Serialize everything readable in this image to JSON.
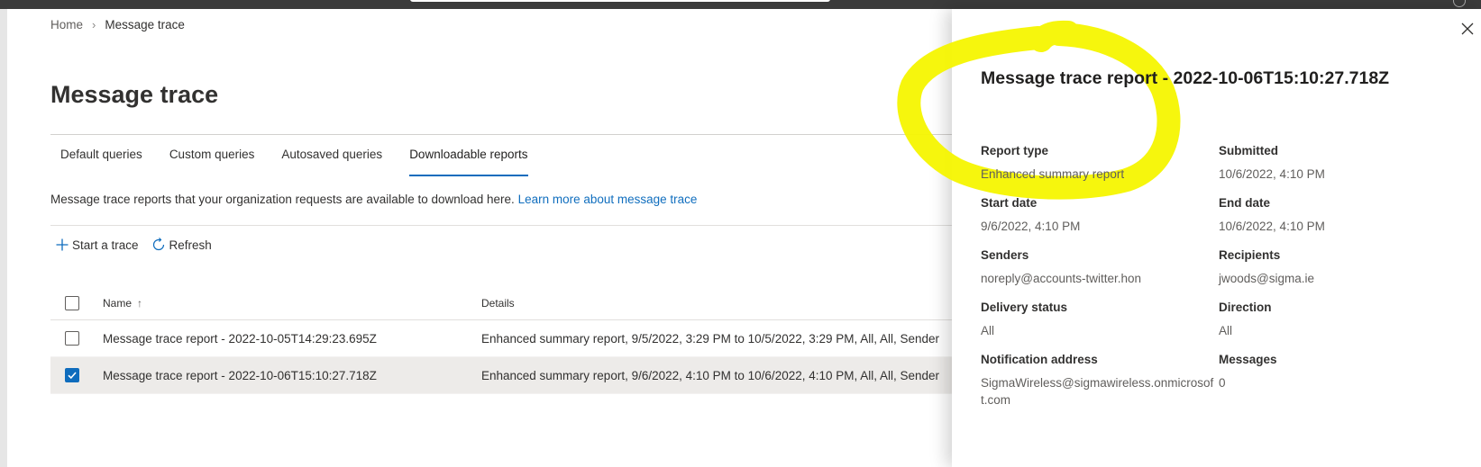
{
  "breadcrumb": {
    "home": "Home",
    "separator": "›",
    "current": "Message trace"
  },
  "page": {
    "title": "Message trace"
  },
  "tabs": [
    {
      "label": "Default queries"
    },
    {
      "label": "Custom queries"
    },
    {
      "label": "Autosaved queries"
    },
    {
      "label": "Downloadable reports",
      "active": true
    }
  ],
  "description": {
    "text": "Message trace reports that your organization requests are available to download here.",
    "link": "Learn more about message trace"
  },
  "commands": {
    "start_trace": "Start a trace",
    "refresh": "Refresh"
  },
  "table": {
    "columns": {
      "name": "Name",
      "details": "Details",
      "sort_indicator": "↑"
    },
    "rows": [
      {
        "name": "Message trace report - 2022-10-05T14:29:23.695Z",
        "details": "Enhanced summary report, 9/5/2022, 3:29 PM to 10/5/2022, 3:29 PM, All, All, Sender",
        "checked": false
      },
      {
        "name": "Message trace report - 2022-10-06T15:10:27.718Z",
        "details": "Enhanced summary report, 9/6/2022, 4:10 PM to 10/6/2022, 4:10 PM, All, All, Sender",
        "checked": true
      }
    ]
  },
  "panel": {
    "title": "Message trace report - 2022-10-06T15:10:27.718Z",
    "fields": {
      "report_type": {
        "label": "Report type",
        "value": "Enhanced summary report"
      },
      "submitted": {
        "label": "Submitted",
        "value": "10/6/2022, 4:10 PM"
      },
      "start_date": {
        "label": "Start date",
        "value": "9/6/2022, 4:10 PM"
      },
      "end_date": {
        "label": "End date",
        "value": "10/6/2022, 4:10 PM"
      },
      "senders": {
        "label": "Senders",
        "value": "noreply@accounts-twitter.hon"
      },
      "recipients": {
        "label": "Recipients",
        "value": "jwoods@sigma.ie"
      },
      "delivery_status": {
        "label": "Delivery status",
        "value": "All"
      },
      "direction": {
        "label": "Direction",
        "value": "All"
      },
      "notification_address": {
        "label": "Notification address",
        "value_line1": "SigmaWireless@sigmawireless.onmicrosof",
        "value_line2": "t.com"
      },
      "messages": {
        "label": "Messages",
        "value": "0"
      }
    }
  },
  "colors": {
    "accent": "#0f6cbd",
    "link": "#106ebe",
    "highlight_marker": "#f5f500",
    "selected_row": "#edebe9"
  },
  "icons": [
    "plus-icon",
    "refresh-icon",
    "checkmark-icon",
    "close-icon",
    "chevron-right-icon",
    "sort-up-icon"
  ]
}
